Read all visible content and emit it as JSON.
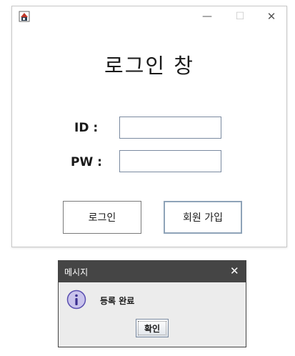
{
  "main_window": {
    "title": "로그인 창",
    "controls": {
      "minimize": "—",
      "maximize": "☐",
      "close": "✕"
    },
    "app_icon": "java-coffee-icon",
    "id_label": "ID :",
    "pw_label": "PW :",
    "id_value": "",
    "pw_value": "",
    "login_button": "로그인",
    "signup_button": "회원 가입"
  },
  "dialog": {
    "title": "메시지",
    "close": "✕",
    "icon": "info-icon",
    "message": "등록 완료",
    "ok_button": "확인"
  },
  "colors": {
    "dialog_titlebar": "#454545",
    "dialog_body": "#ececec",
    "info_icon_fill": "#c9c3ec",
    "info_icon_stroke": "#5a4fb0"
  }
}
